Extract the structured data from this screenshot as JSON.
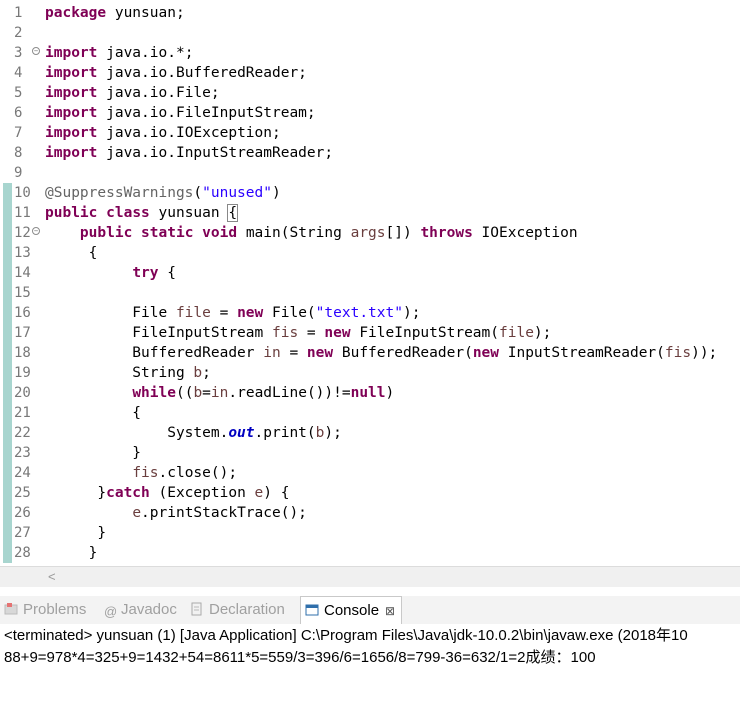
{
  "editor": {
    "lines": [
      {
        "n": "1",
        "html": "<span class='kw'>package</span> yunsuan;"
      },
      {
        "n": "2",
        "html": ""
      },
      {
        "n": "3",
        "html": "<span class='kw'>import</span> java.io.*;",
        "fold": true
      },
      {
        "n": "4",
        "html": "<span class='kw'>import</span> java.io.BufferedReader;"
      },
      {
        "n": "5",
        "html": "<span class='kw'>import</span> java.io.File;"
      },
      {
        "n": "6",
        "html": "<span class='kw'>import</span> java.io.FileInputStream;"
      },
      {
        "n": "7",
        "html": "<span class='kw'>import</span> java.io.IOException;"
      },
      {
        "n": "8",
        "html": "<span class='kw'>import</span> java.io.InputStreamReader;"
      },
      {
        "n": "9",
        "html": ""
      },
      {
        "n": "10",
        "html": "<span class='ann'>@SuppressWarnings</span>(<span class='str'>\"unused\"</span>)"
      },
      {
        "n": "11",
        "html": "<span class='kw'>public</span> <span class='kw'>class</span> yunsuan <span class='bm'>{</span>"
      },
      {
        "n": "12",
        "html": "    <span class='kw'>public</span> <span class='kw'>static</span> <span class='kw'>void</span> main(String <span class='var'>args</span>[]) <span class='kw'>throws</span> IOException",
        "fold": true
      },
      {
        "n": "13",
        "html": "     {"
      },
      {
        "n": "14",
        "html": "          <span class='kw'>try</span> {"
      },
      {
        "n": "15",
        "html": ""
      },
      {
        "n": "16",
        "html": "          File <span class='var'>file</span> = <span class='kw'>new</span> File(<span class='str'>\"text.txt\"</span>);"
      },
      {
        "n": "17",
        "html": "          FileInputStream <span class='var'>fis</span> = <span class='kw'>new</span> FileInputStream(<span class='var'>file</span>);"
      },
      {
        "n": "18",
        "html": "          BufferedReader <span class='var'>in</span> = <span class='kw'>new</span> BufferedReader(<span class='kw'>new</span> InputStreamReader(<span class='var'>fis</span>));"
      },
      {
        "n": "19",
        "html": "          String <span class='var'>b</span>;"
      },
      {
        "n": "20",
        "html": "          <span class='kw'>while</span>((<span class='var'>b</span>=<span class='var'>in</span>.readLine())!=<span class='kw'>null</span>)"
      },
      {
        "n": "21",
        "html": "          {"
      },
      {
        "n": "22",
        "html": "              System.<span class='fld'>out</span>.print(<span class='var'>b</span>);"
      },
      {
        "n": "23",
        "html": "          }"
      },
      {
        "n": "24",
        "html": "          <span class='var'>fis</span>.close();"
      },
      {
        "n": "25",
        "html": "      }<span class='kw'>catch</span> (Exception <span class='var'>e</span>) {"
      },
      {
        "n": "26",
        "html": "          <span class='var'>e</span>.printStackTrace();"
      },
      {
        "n": "27",
        "html": "      }"
      },
      {
        "n": "28",
        "html": "     }"
      }
    ]
  },
  "scroll": {
    "left_arrow": "<"
  },
  "tabs": [
    {
      "id": "problems",
      "label": "Problems",
      "icon": "problems-icon"
    },
    {
      "id": "javadoc",
      "label": "Javadoc",
      "icon": "at-icon"
    },
    {
      "id": "declaration",
      "label": "Declaration",
      "icon": "declaration-icon"
    },
    {
      "id": "console",
      "label": "Console",
      "icon": "console-icon",
      "active": true
    }
  ],
  "console": {
    "close_glyph": "⊠",
    "status": "<terminated> yunsuan (1) [Java Application] C:\\Program Files\\Java\\jdk-10.0.2\\bin\\javaw.exe (2018年10",
    "output": "88+9=978*4=325+9=1432+54=8611*5=559/3=396/6=1656/8=799-36=632/1=2成绩：100"
  }
}
